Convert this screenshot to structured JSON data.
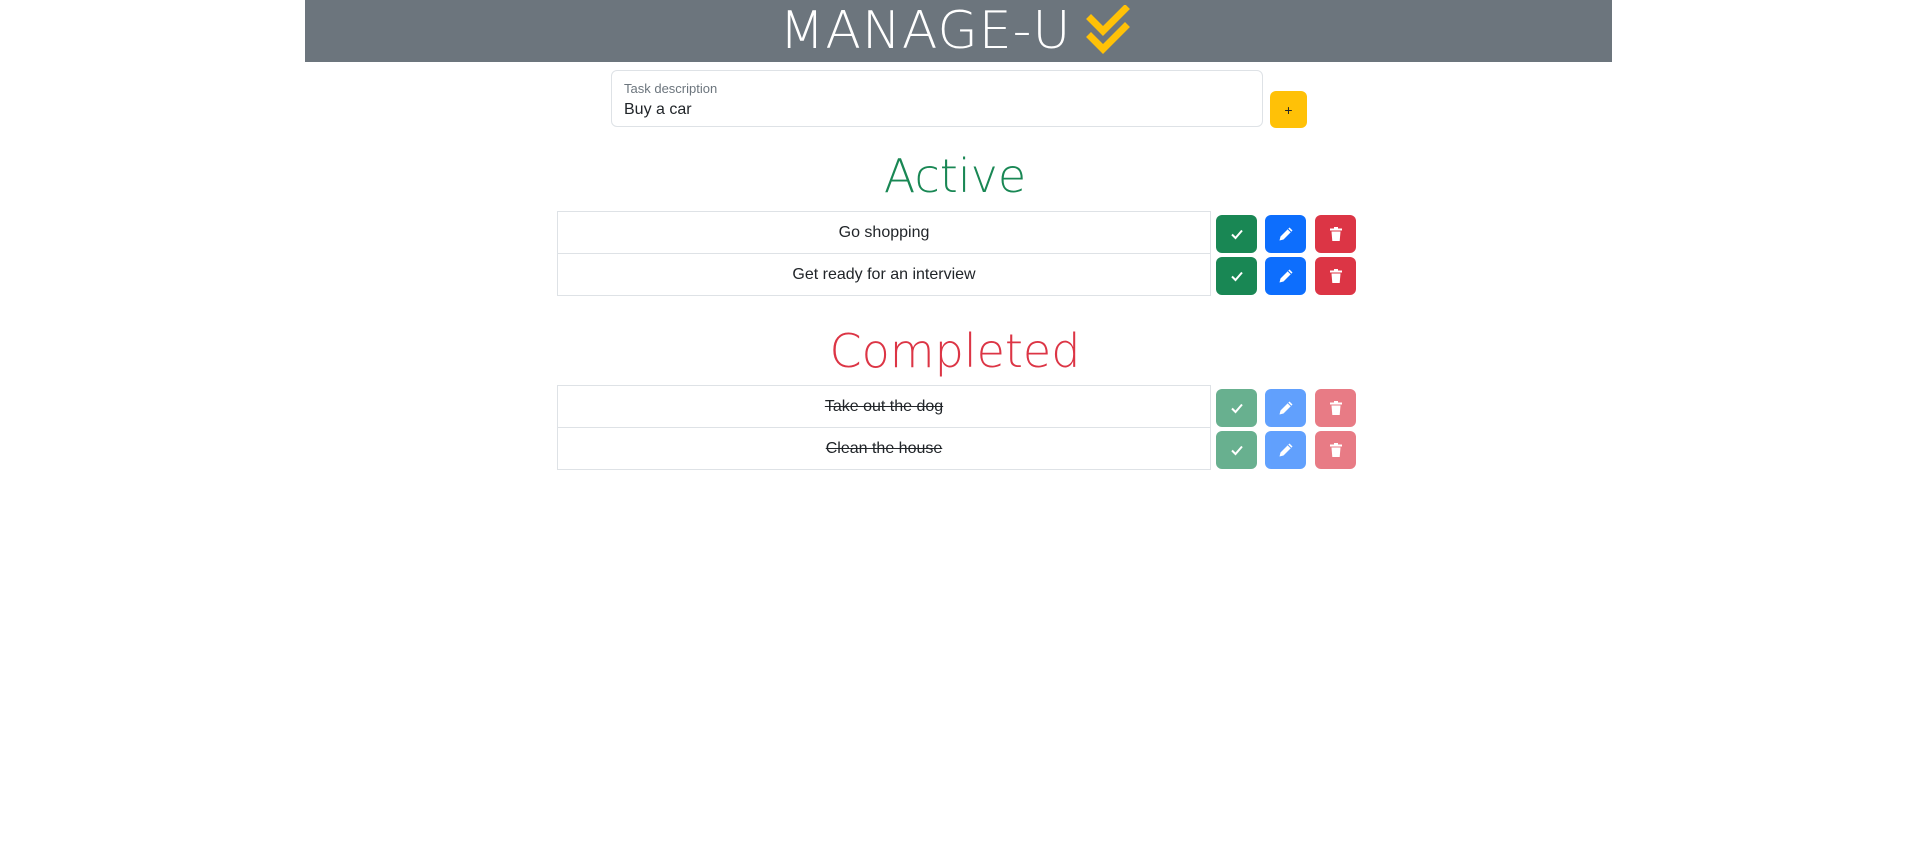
{
  "header": {
    "title": "MANAGE-U",
    "logo_icon": "double-check-icon",
    "logo_color": "#ffc107",
    "background": "#6c757d"
  },
  "task_form": {
    "label": "Task description",
    "value": "Buy a car",
    "add_label": "+"
  },
  "active": {
    "heading": "Active",
    "color": "#198754",
    "tasks": [
      {
        "text": "Go shopping"
      },
      {
        "text": "Get ready for an interview"
      }
    ]
  },
  "completed": {
    "heading": "Completed",
    "color": "#dc3545",
    "tasks": [
      {
        "text": "Take out the dog"
      },
      {
        "text": "Clean the house"
      }
    ]
  },
  "actions": {
    "complete_icon": "check-icon",
    "edit_icon": "pencil-icon",
    "delete_icon": "trash-icon",
    "complete_color": "#198754",
    "edit_color": "#0d6efd",
    "delete_color": "#dc3545"
  }
}
